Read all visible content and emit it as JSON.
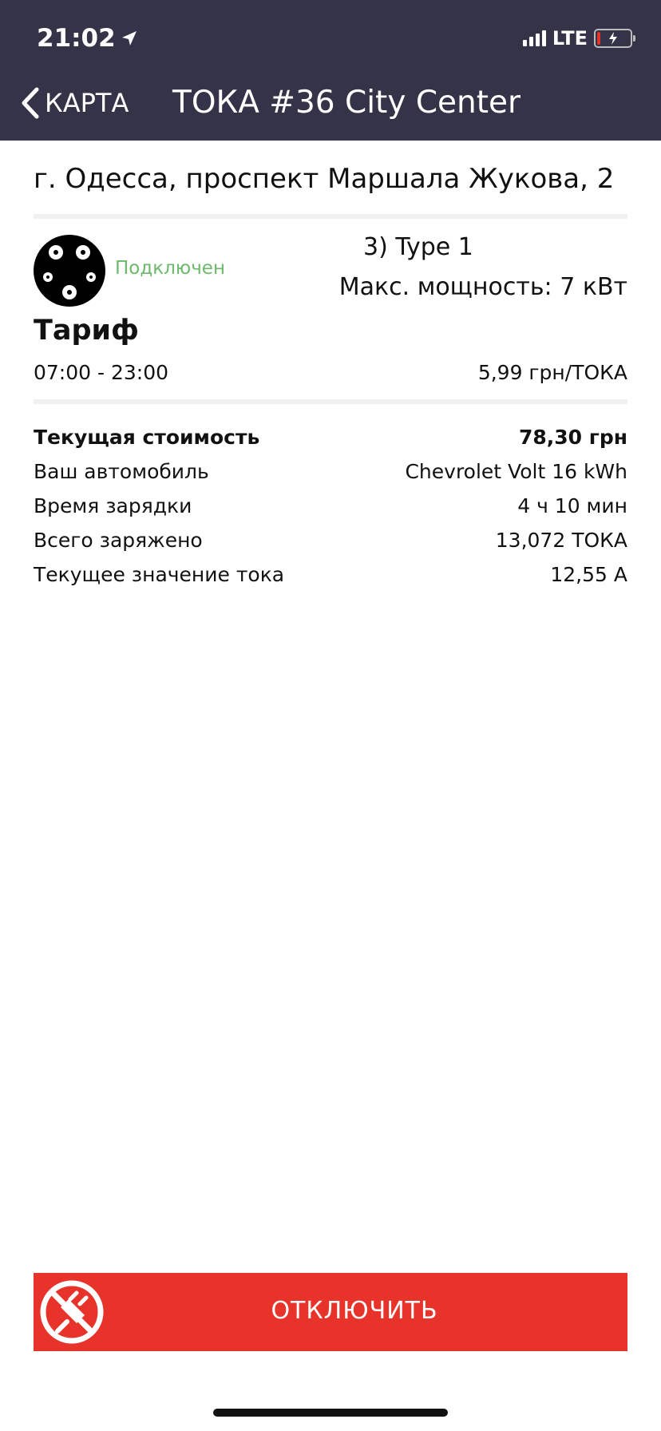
{
  "status_bar": {
    "time": "21:02",
    "network": "LTE"
  },
  "nav": {
    "back_label": "КАРТА",
    "title": "ТОКА #36 City Center"
  },
  "station": {
    "address": "г. Одесса, проспект Маршала Жукова, 2"
  },
  "connector": {
    "status": "Подключен",
    "type": "3) Type 1",
    "max_power": "Макс. мощность: 7 кВт"
  },
  "tariff": {
    "title": "Тариф",
    "hours": "07:00 - 23:00",
    "price": "5,99 грн/ТОКА"
  },
  "info": {
    "rows": [
      {
        "label": "Текущая стоимость",
        "value": "78,30 грн"
      },
      {
        "label": "Ваш автомобиль",
        "value": "Chevrolet Volt 16 kWh"
      },
      {
        "label": "Время зарядки",
        "value": "4 ч 10 мин"
      },
      {
        "label": "Всего заряжено",
        "value": "13,072 ТОКА"
      },
      {
        "label": "Текущее значение тока",
        "value": "12,55 А"
      }
    ]
  },
  "action": {
    "disconnect_label": "ОТКЛЮЧИТЬ"
  },
  "colors": {
    "header_bg": "#353347",
    "accent_red": "#e8332a",
    "status_green": "#6db86b"
  }
}
